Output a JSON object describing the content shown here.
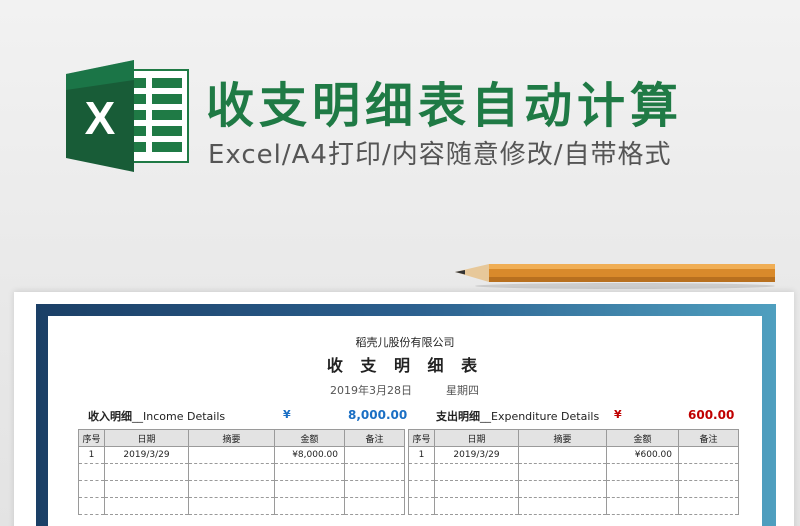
{
  "banner": {
    "logo_letter": "X",
    "title": "收支明细表自动计算",
    "subtitle": "Excel/A4打印/内容随意修改/自带格式",
    "colors": {
      "brand_green": "#1f7a45",
      "logo_dark": "#185c37"
    }
  },
  "report": {
    "company": "稻壳儿股份有限公司",
    "title": "收 支 明 细 表",
    "date": "2019年3月28日",
    "weekday": "星期四"
  },
  "income": {
    "label_cn": "收入明细",
    "label_en": "__Income Details",
    "currency": "¥",
    "total": "8,000.00",
    "color": "#1a6fc4",
    "columns": [
      "序号",
      "日期",
      "摘要",
      "金额",
      "备注"
    ],
    "rows": [
      [
        "1",
        "2019/3/29",
        "",
        "¥8,000.00",
        ""
      ],
      [
        "",
        "",
        "",
        "",
        ""
      ],
      [
        "",
        "",
        "",
        "",
        ""
      ],
      [
        "",
        "",
        "",
        "",
        ""
      ]
    ]
  },
  "expenditure": {
    "label_cn": "支出明细",
    "label_en": "__Expenditure Details",
    "currency": "¥",
    "total": "600.00",
    "color": "#c00000",
    "columns": [
      "序号",
      "日期",
      "摘要",
      "金额",
      "备注"
    ],
    "rows": [
      [
        "1",
        "2019/3/29",
        "",
        "¥600.00",
        ""
      ],
      [
        "",
        "",
        "",
        "",
        ""
      ],
      [
        "",
        "",
        "",
        "",
        ""
      ],
      [
        "",
        "",
        "",
        "",
        ""
      ]
    ]
  }
}
